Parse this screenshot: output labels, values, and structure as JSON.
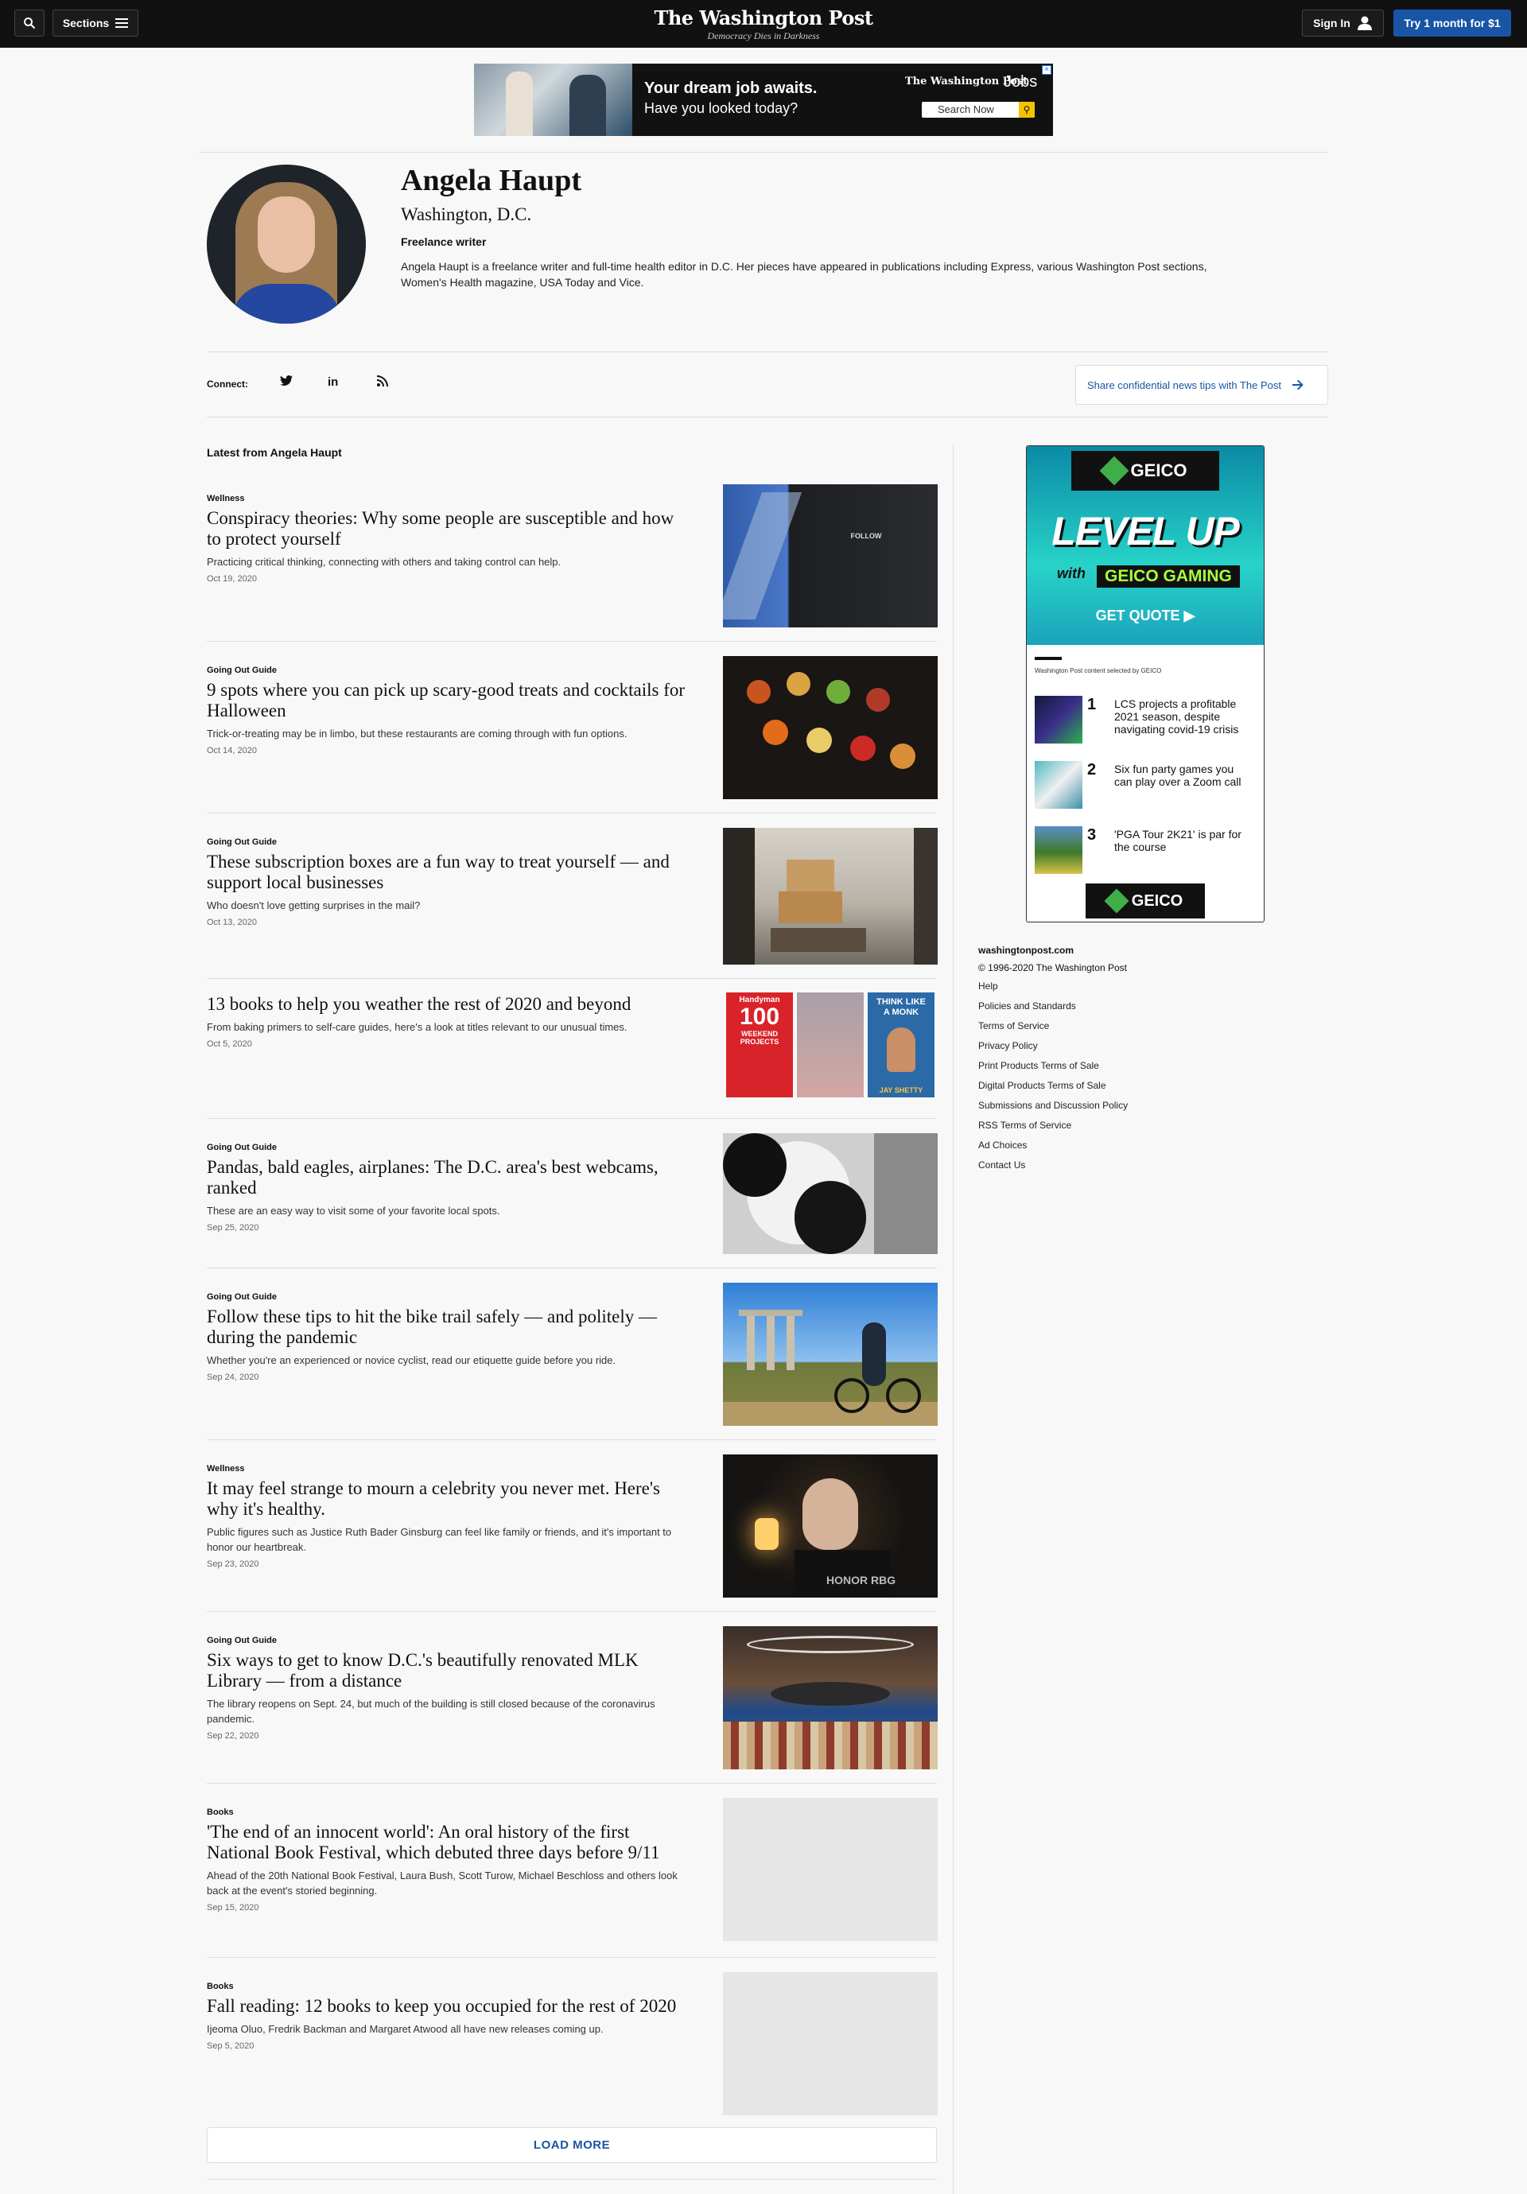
{
  "header": {
    "search_label": "",
    "sections_label": "Sections",
    "logo": "The Washington Post",
    "tagline": "Democracy Dies in Darkness",
    "signin_label": "Sign In",
    "subscribe_label": "Try 1 month for $1"
  },
  "top_ad": {
    "headline": "Your dream job awaits.",
    "subline": "Have you looked today?",
    "brand": "The Washington Post",
    "jobs": "Jobs",
    "search_label": "Search Now"
  },
  "profile": {
    "name": "Angela Haupt",
    "location": "Washington, D.C.",
    "role": "Freelance writer",
    "bio": "Angela Haupt is a freelance writer and full-time health editor in D.C. Her pieces have appeared in publications including Express, various Washington Post sections, Women's Health magazine, USA Today and Vice."
  },
  "connect": {
    "label": "Connect:",
    "tips_label": "Share confidential news tips with The Post"
  },
  "latest": {
    "title": "Latest from Angela Haupt",
    "load_more": "LOAD MORE"
  },
  "articles": [
    {
      "kicker": "Wellness",
      "headline": "Conspiracy theories: Why some people are susceptible and how to protect yourself",
      "blurb": "Practicing critical thinking, connecting with others and taking control can help.",
      "date": "Oct 19, 2020"
    },
    {
      "kicker": "Going Out Guide",
      "headline": "9 spots where you can pick up scary-good treats and cocktails for Halloween",
      "blurb": "Trick-or-treating may be in limbo, but these restaurants are coming through with fun options.",
      "date": "Oct 14, 2020"
    },
    {
      "kicker": "Going Out Guide",
      "headline": "These subscription boxes are a fun way to treat yourself — and support local businesses",
      "blurb": "Who doesn't love getting surprises in the mail?",
      "date": "Oct 13, 2020"
    },
    {
      "kicker": "",
      "headline": "13 books to help you weather the rest of 2020 and beyond",
      "blurb": "From baking primers to self-care guides, here's a look at titles relevant to our unusual times.",
      "date": "Oct 5, 2020"
    },
    {
      "kicker": "Going Out Guide",
      "headline": "Pandas, bald eagles, airplanes: The D.C. area's best webcams, ranked",
      "blurb": "These are an easy way to visit some of your favorite local spots.",
      "date": "Sep 25, 2020"
    },
    {
      "kicker": "Going Out Guide",
      "headline": "Follow these tips to hit the bike trail safely — and politely — during the pandemic",
      "blurb": "Whether you're an experienced or novice cyclist, read our etiquette guide before you ride.",
      "date": "Sep 24, 2020"
    },
    {
      "kicker": "Wellness",
      "headline": "It may feel strange to mourn a celebrity you never met. Here's why it's healthy.",
      "blurb": "Public figures such as Justice Ruth Bader Ginsburg can feel like family or friends, and it's important to honor our heartbreak.",
      "date": "Sep 23, 2020"
    },
    {
      "kicker": "Going Out Guide",
      "headline": "Six ways to get to know D.C.'s beautifully renovated MLK Library — from a distance",
      "blurb": "The library reopens on Sept. 24, but much of the building is still closed because of the coronavirus pandemic.",
      "date": "Sep 22, 2020"
    },
    {
      "kicker": "Books",
      "headline": "'The end of an innocent world': An oral history of the first National Book Festival, which debuted three days before 9/11",
      "blurb": "Ahead of the 20th National Book Festival, Laura Bush, Scott Turow, Michael Beschloss and others look back at the event's storied beginning.",
      "date": "Sep 15, 2020"
    },
    {
      "kicker": "Books",
      "headline": "Fall reading: 12 books to keep you occupied for the rest of 2020",
      "blurb": "Ijeoma Oluo, Fredrik Backman and Margaret Atwood all have new releases coming up.",
      "date": "Sep 5, 2020"
    }
  ],
  "thumbs": {
    "hoodie_text": "FOLLOW",
    "books_cover_1_title": "100",
    "books_cover_1_sub": "WEEKEND PROJECTS",
    "books_cover_1_brand": "Handyman",
    "books_cover_3_title": "THINK LIKE A MONK",
    "books_cover_3_author": "JAY SHETTY",
    "vigil_sign": "HONOR RBG"
  },
  "side_ad": {
    "brand": "GEICO",
    "brand_sub": "GAMING",
    "big": "LEVEL UP",
    "with": "with",
    "gaming": "GEICO GAMING",
    "cta": "GET QUOTE ▶",
    "selected_by": "Washington Post content selected by GEICO",
    "items": [
      {
        "num": "1",
        "text": "LCS projects a profitable 2021 season, despite navigating covid-19 crisis"
      },
      {
        "num": "2",
        "text": "Six fun party games you can play over a Zoom call"
      },
      {
        "num": "3",
        "text": "'PGA Tour 2K21' is par for the course"
      }
    ]
  },
  "footer": {
    "site": "washingtonpost.com",
    "copyright": "© 1996-2020 The Washington Post",
    "links": [
      "Help",
      "Policies and Standards",
      "Terms of Service",
      "Privacy Policy",
      "Print Products Terms of Sale",
      "Digital Products Terms of Sale",
      "Submissions and Discussion Policy",
      "RSS Terms of Service",
      "Ad Choices",
      "Contact Us"
    ]
  },
  "colors": {
    "accent": "#1955a5",
    "nav_bg": "#111111",
    "page_bg": "#f8f8f8"
  }
}
